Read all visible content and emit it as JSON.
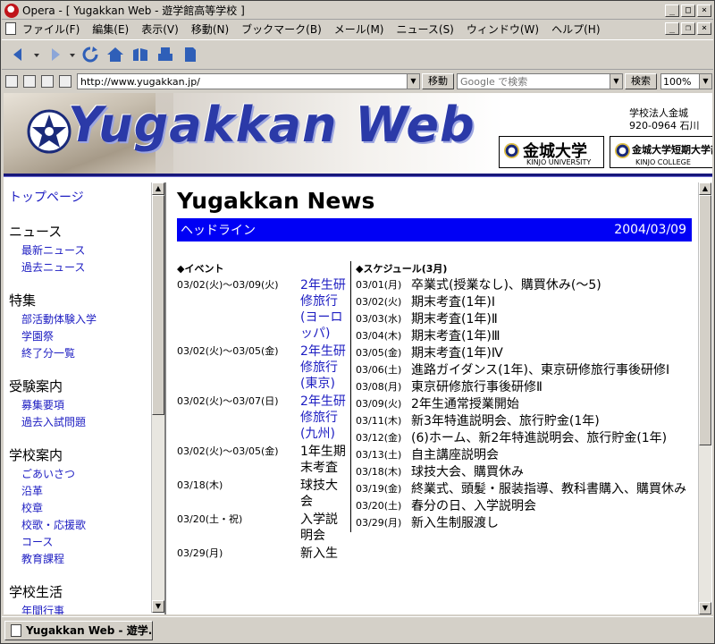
{
  "window": {
    "title": "Opera - [ Yugakkan Web - 遊学館高等学校 ]"
  },
  "menubar": [
    "ファイル(F)",
    "編集(E)",
    "表示(V)",
    "移動(N)",
    "ブックマーク(B)",
    "メール(M)",
    "ニュース(S)",
    "ウィンドウ(W)",
    "ヘルプ(H)"
  ],
  "address": {
    "url": "http://www.yugakkan.jp/",
    "go_label": "移動",
    "search_placeholder": "Google で検索",
    "search_button": "検索",
    "zoom": "100%"
  },
  "banner": {
    "logo": "Yugakkan Web",
    "corp_line1": "学校法人金城",
    "corp_line2": "920-0964 石川",
    "uni1_main": "金城大学",
    "uni1_sub": "KINJO UNIVERSITY",
    "uni2_main": "金城大学短期大学部",
    "uni2_sub": "KINJO COLLEGE"
  },
  "nav": {
    "top": "トップページ",
    "sections": [
      {
        "title": "ニュース",
        "links": [
          "最新ニュース",
          "過去ニュース"
        ]
      },
      {
        "title": "特集",
        "links": [
          "部活動体験入学",
          "学園祭",
          "終了分一覧"
        ]
      },
      {
        "title": "受験案内",
        "links": [
          "募集要項",
          "過去入試問題"
        ]
      },
      {
        "title": "学校案内",
        "links": [
          "ごあいさつ",
          "沿革",
          "校章",
          "校歌・応援歌",
          "コース",
          "教育課程"
        ]
      },
      {
        "title": "学校生活",
        "links": [
          "年間行事"
        ]
      }
    ]
  },
  "main": {
    "title": "Yugakkan News",
    "headline_label": "ヘッドライン",
    "headline_date": "2004/03/09",
    "events_heading": "◆イベント",
    "events": [
      {
        "date": "03/02(火)～03/09(火)",
        "text": "2年生研修旅行(ヨーロッパ)",
        "link": true
      },
      {
        "date": "03/02(火)～03/05(金)",
        "text": "2年生研修旅行(東京)",
        "link": true
      },
      {
        "date": "03/02(火)～03/07(日)",
        "text": "2年生研修旅行(九州)",
        "link": true
      },
      {
        "date": "03/02(火)～03/05(金)",
        "text": "1年生期末考査",
        "link": false
      },
      {
        "date": "03/18(木)",
        "text": "球技大会",
        "link": false
      },
      {
        "date": "03/20(土・祝)",
        "text": "入学説明会",
        "link": false
      },
      {
        "date": "03/29(月)",
        "text": "新入生",
        "link": false
      }
    ],
    "schedule_heading": "◆スケジュール(3月)",
    "schedule": [
      {
        "date": "03/01(月)",
        "text": "卒業式(授業なし)、購買休み(～5)"
      },
      {
        "date": "03/02(火)",
        "text": "期末考査(1年)Ⅰ"
      },
      {
        "date": "03/03(水)",
        "text": "期末考査(1年)Ⅱ"
      },
      {
        "date": "03/04(木)",
        "text": "期末考査(1年)Ⅲ"
      },
      {
        "date": "03/05(金)",
        "text": "期末考査(1年)Ⅳ"
      },
      {
        "date": "03/06(土)",
        "text": "進路ガイダンス(1年)、東京研修旅行事後研修Ⅰ"
      },
      {
        "date": "03/08(月)",
        "text": "東京研修旅行事後研修Ⅱ"
      },
      {
        "date": "03/09(火)",
        "text": "2年生通常授業開始"
      },
      {
        "date": "03/11(木)",
        "text": "新3年特進説明会、旅行貯金(1年)"
      },
      {
        "date": "03/12(金)",
        "text": "(6)ホーム、新2年特進説明会、旅行貯金(1年)"
      },
      {
        "date": "03/13(土)",
        "text": "自主講座説明会"
      },
      {
        "date": "03/18(木)",
        "text": "球技大会、購買休み"
      },
      {
        "date": "03/19(金)",
        "text": "終業式、頭髪・服装指導、教科書購入、購買休み"
      },
      {
        "date": "03/20(土)",
        "text": "春分の日、入学説明会"
      },
      {
        "date": "03/29(月)",
        "text": "新入生制服渡し"
      }
    ]
  },
  "statusbar": {
    "tab_label": "Yugakkan Web - 遊学..."
  },
  "colors": {
    "headline_bg": "#0000f5",
    "logo_blue": "#2b3aa8",
    "link": "#1d1dc2",
    "banner_rule": "#17177a"
  }
}
